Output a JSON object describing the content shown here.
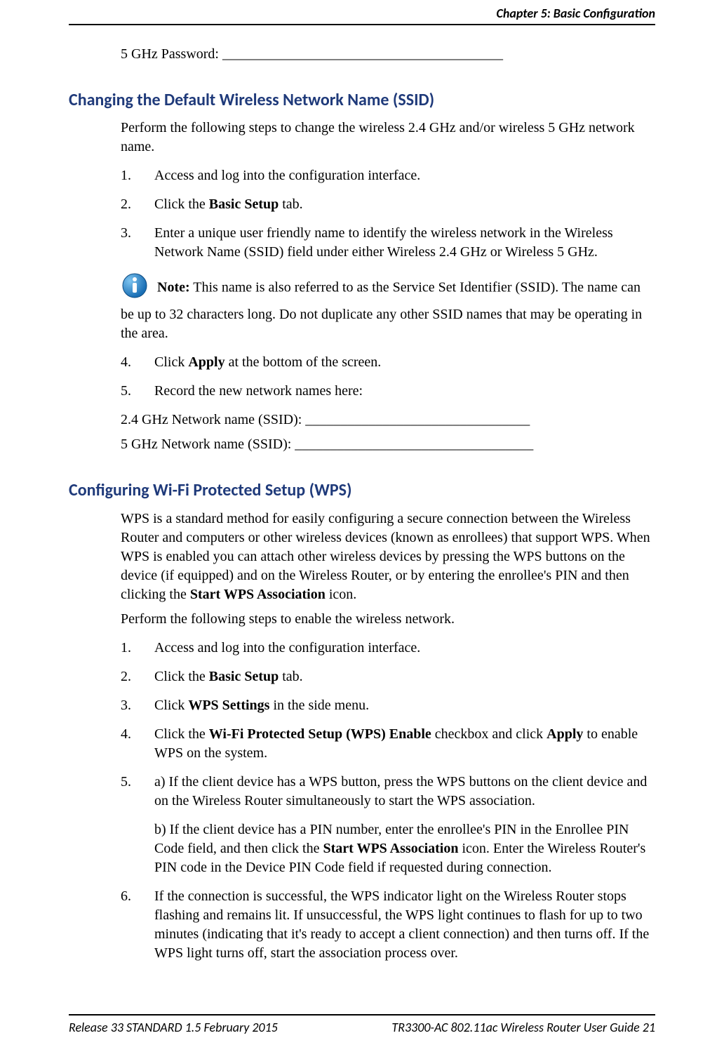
{
  "header": {
    "chapter": "Chapter 5: Basic Configuration"
  },
  "pwd_label": "5 GHz Password: ________________________________________",
  "section1": {
    "heading": "Changing the Default Wireless Network Name (SSID)",
    "intro": "Perform the following steps to change the wireless 2.4 GHz and/or wireless 5 GHz network name.",
    "step1": "Access and log into the configuration interface.",
    "step2_pre": "Click the ",
    "step2_bold": "Basic Setup",
    "step2_post": " tab.",
    "step3": "Enter a unique user friendly name to identify the wireless network in the Wireless Network Name (SSID) field under either Wireless 2.4 GHz or Wireless 5 GHz.",
    "note_label": "Note:",
    "note_text": "  This name is also referred to as the Service Set Identifier (SSID).  The name can be up to 32 characters long. Do not duplicate any other SSID names that may be operating in the area.",
    "step4_pre": "Click ",
    "step4_bold": "Apply",
    "step4_post": " at the bottom of the screen.",
    "step5": "Record the new network names here:",
    "record24": "2.4 GHz Network name (SSID): ________________________________",
    "record5": "5 GHz Network name (SSID): __________________________________"
  },
  "section2": {
    "heading": "Configuring Wi-Fi Protected Setup (WPS)",
    "intro_pre": "WPS is a standard method for easily configuring a secure connection between the Wireless Router and computers or other wireless devices (known as enrollees) that support WPS.  When WPS is enabled you can attach other wireless devices by pressing the WPS buttons on the device (if equipped) and on the Wireless Router, or by entering the enrollee's PIN and then clicking the ",
    "intro_bold": "Start WPS Association",
    "intro_post": " icon.",
    "perform": "Perform the following steps to enable the wireless network.",
    "step1": "Access and log into the configuration interface.",
    "step2_pre": "Click the ",
    "step2_bold": "Basic Setup",
    "step2_post": " tab.",
    "step3_pre": "Click ",
    "step3_bold": "WPS Settings",
    "step3_post": " in the side menu.",
    "step4_pre": "Click the ",
    "step4_bold": "Wi-Fi Protected Setup (WPS) Enable",
    "step4_mid": " checkbox and click ",
    "step4_bold2": "Apply",
    "step4_post": " to enable WPS on the system.",
    "step5a": "a)  If the client device has a WPS button, press the WPS buttons on the client device and on the Wireless Router simultaneously to start the WPS association.",
    "step5b_pre": "b) If the client device has a PIN number, enter the enrollee's PIN in the Enrollee PIN Code field, and then click the ",
    "step5b_bold": "Start WPS Association",
    "step5b_post": " icon.  Enter the Wireless Router's PIN code in the Device PIN Code field if requested during connection.",
    "step6": "If the connection is successful, the WPS indicator light on the Wireless Router stops flashing and remains lit.  If unsuccessful, the WPS light continues to flash for up to two minutes (indicating that it's ready to accept a client connection) and then turns off.  If the WPS light turns off, start the association process over."
  },
  "footer": {
    "left": "Release 33 STANDARD 1.5    February 2015",
    "right": "TR3300-AC 802.11ac Wireless Router User Guide    21"
  }
}
